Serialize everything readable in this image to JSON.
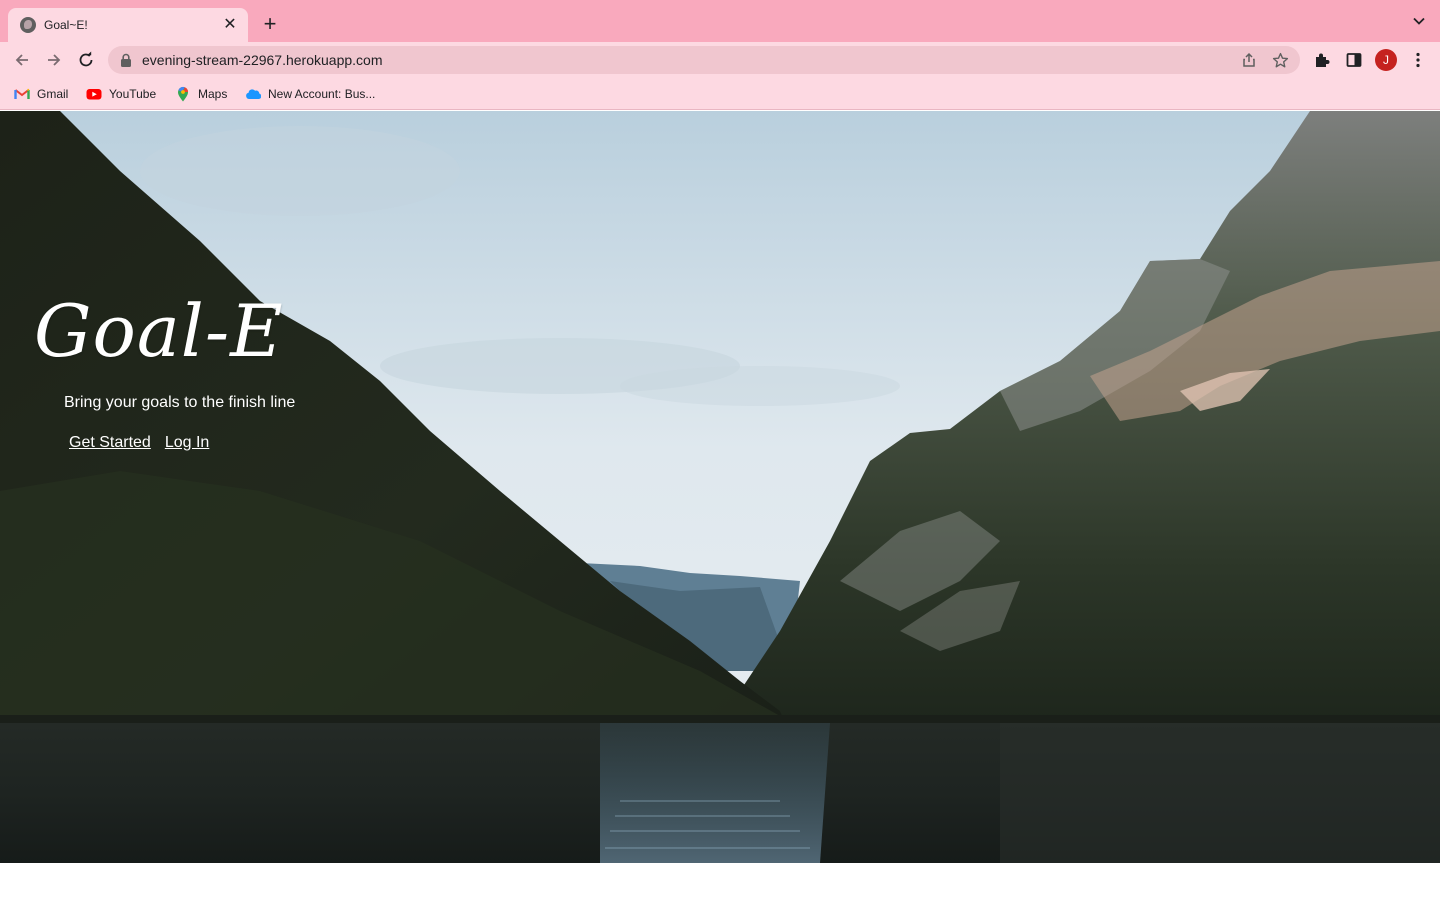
{
  "browser": {
    "tab": {
      "title": "Goal~E!",
      "close_glyph": "✕"
    },
    "new_tab_glyph": "+",
    "address": {
      "url": "evening-stream-22967.herokuapp.com"
    },
    "profile_initial": "J",
    "bookmarks": [
      {
        "label": "Gmail",
        "icon": "gmail-icon"
      },
      {
        "label": "YouTube",
        "icon": "youtube-icon"
      },
      {
        "label": "Maps",
        "icon": "maps-icon"
      },
      {
        "label": "New Account: Bus...",
        "icon": "salesforce-cloud-icon"
      }
    ],
    "colors": {
      "tabstrip": "#f9a9bd",
      "toolbar": "#fdd9e2",
      "omnibox": "#f0c6cf",
      "avatar": "#c5221f"
    }
  },
  "page": {
    "title": "Goal-E",
    "tagline": "Bring your goals to the finish line",
    "links": {
      "get_started": "Get Started",
      "log_in": "Log In"
    }
  }
}
